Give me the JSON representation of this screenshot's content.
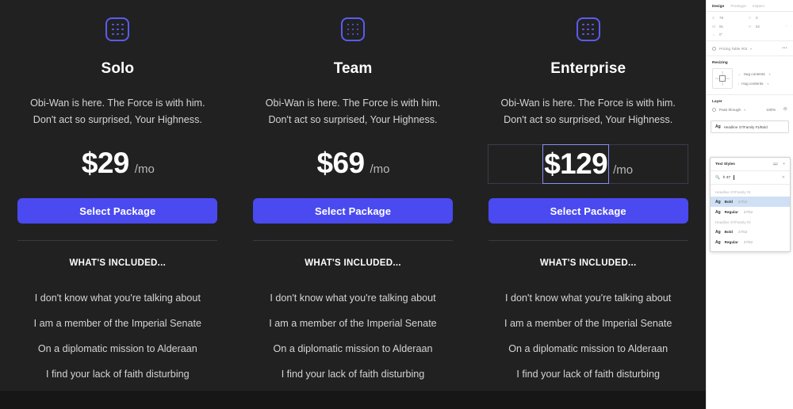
{
  "canvas": {
    "background": "#161616",
    "card_background": "#212121"
  },
  "pricing": {
    "plans": [
      {
        "icon": "grid-dots-icon",
        "name": "Solo",
        "description": "Obi-Wan is here. The Force is with him. Don't act so surprised, Your Highness.",
        "price": "$29",
        "period": "/mo",
        "cta": "Select Package",
        "included_label": "WHAT'S INCLUDED...",
        "features": [
          "I don't know what you're talking about",
          "I am a member of the Imperial Senate",
          "On a diplomatic mission to Alderaan",
          "I find your lack of faith disturbing"
        ],
        "selected": false
      },
      {
        "icon": "grid-dots-icon",
        "name": "Team",
        "description": "Obi-Wan is here. The Force is with him. Don't act so surprised, Your Highness.",
        "price": "$69",
        "period": "/mo",
        "cta": "Select Package",
        "included_label": "WHAT'S INCLUDED...",
        "features": [
          "I don't know what you're talking about",
          "I am a member of the Imperial Senate",
          "On a diplomatic mission to Alderaan",
          "I find your lack of faith disturbing"
        ],
        "selected": false
      },
      {
        "icon": "grid-dots-icon",
        "name": "Enterprise",
        "description": "Obi-Wan is here. The Force is with him. Don't act so surprised, Your Highness.",
        "price": "$129",
        "period": "/mo",
        "cta": "Select Package",
        "included_label": "WHAT'S INCLUDED...",
        "features": [
          "I don't know what you're talking about",
          "I am a member of the Imperial Senate",
          "On a diplomatic mission to Alderaan",
          "I find your lack of faith disturbing"
        ],
        "selected": true
      }
    ],
    "accent_color": "#4a4af0",
    "icon_color": "#5b5bf0",
    "selection_color": "#8b8bf5"
  },
  "inspector": {
    "tabs": [
      {
        "label": "Design",
        "active": true
      },
      {
        "label": "Prototype",
        "active": false
      },
      {
        "label": "Inspect",
        "active": false
      }
    ],
    "geometry": {
      "x_key": "X",
      "x_value": "78",
      "y_key": "Y",
      "y_value": "0",
      "w_key": "W",
      "w_value": "91",
      "h_key": "H",
      "h_value": "62",
      "angle_value": "0°"
    },
    "selection_name": "Pricing Table #03",
    "more_menu": "•••",
    "resizing": {
      "title": "Resizing",
      "horizontal": "Hug contents",
      "vertical": "Hug contents"
    },
    "layer": {
      "title": "Layer",
      "blend_mode": "Pass through",
      "opacity": "100%"
    },
    "current_text_style": {
      "ag": "Ag",
      "label": "Headline 37/Family #1/Bold"
    },
    "style_popup": {
      "title": "Text Styles",
      "search_value": "h 37",
      "groups": [
        {
          "label": "Headline 37/Family #1",
          "items": [
            {
              "ag": "Ag",
              "name": "Bold",
              "size": "37/52",
              "selected": true
            },
            {
              "ag": "Ag",
              "name": "Regular",
              "size": "37/52",
              "selected": false
            }
          ]
        },
        {
          "label": "Headline 37/Family #2",
          "items": [
            {
              "ag": "Ag",
              "name": "Bold",
              "size": "37/52",
              "selected": false
            },
            {
              "ag": "Ag",
              "name": "Regular",
              "size": "37/52",
              "selected": false
            }
          ]
        }
      ]
    }
  }
}
